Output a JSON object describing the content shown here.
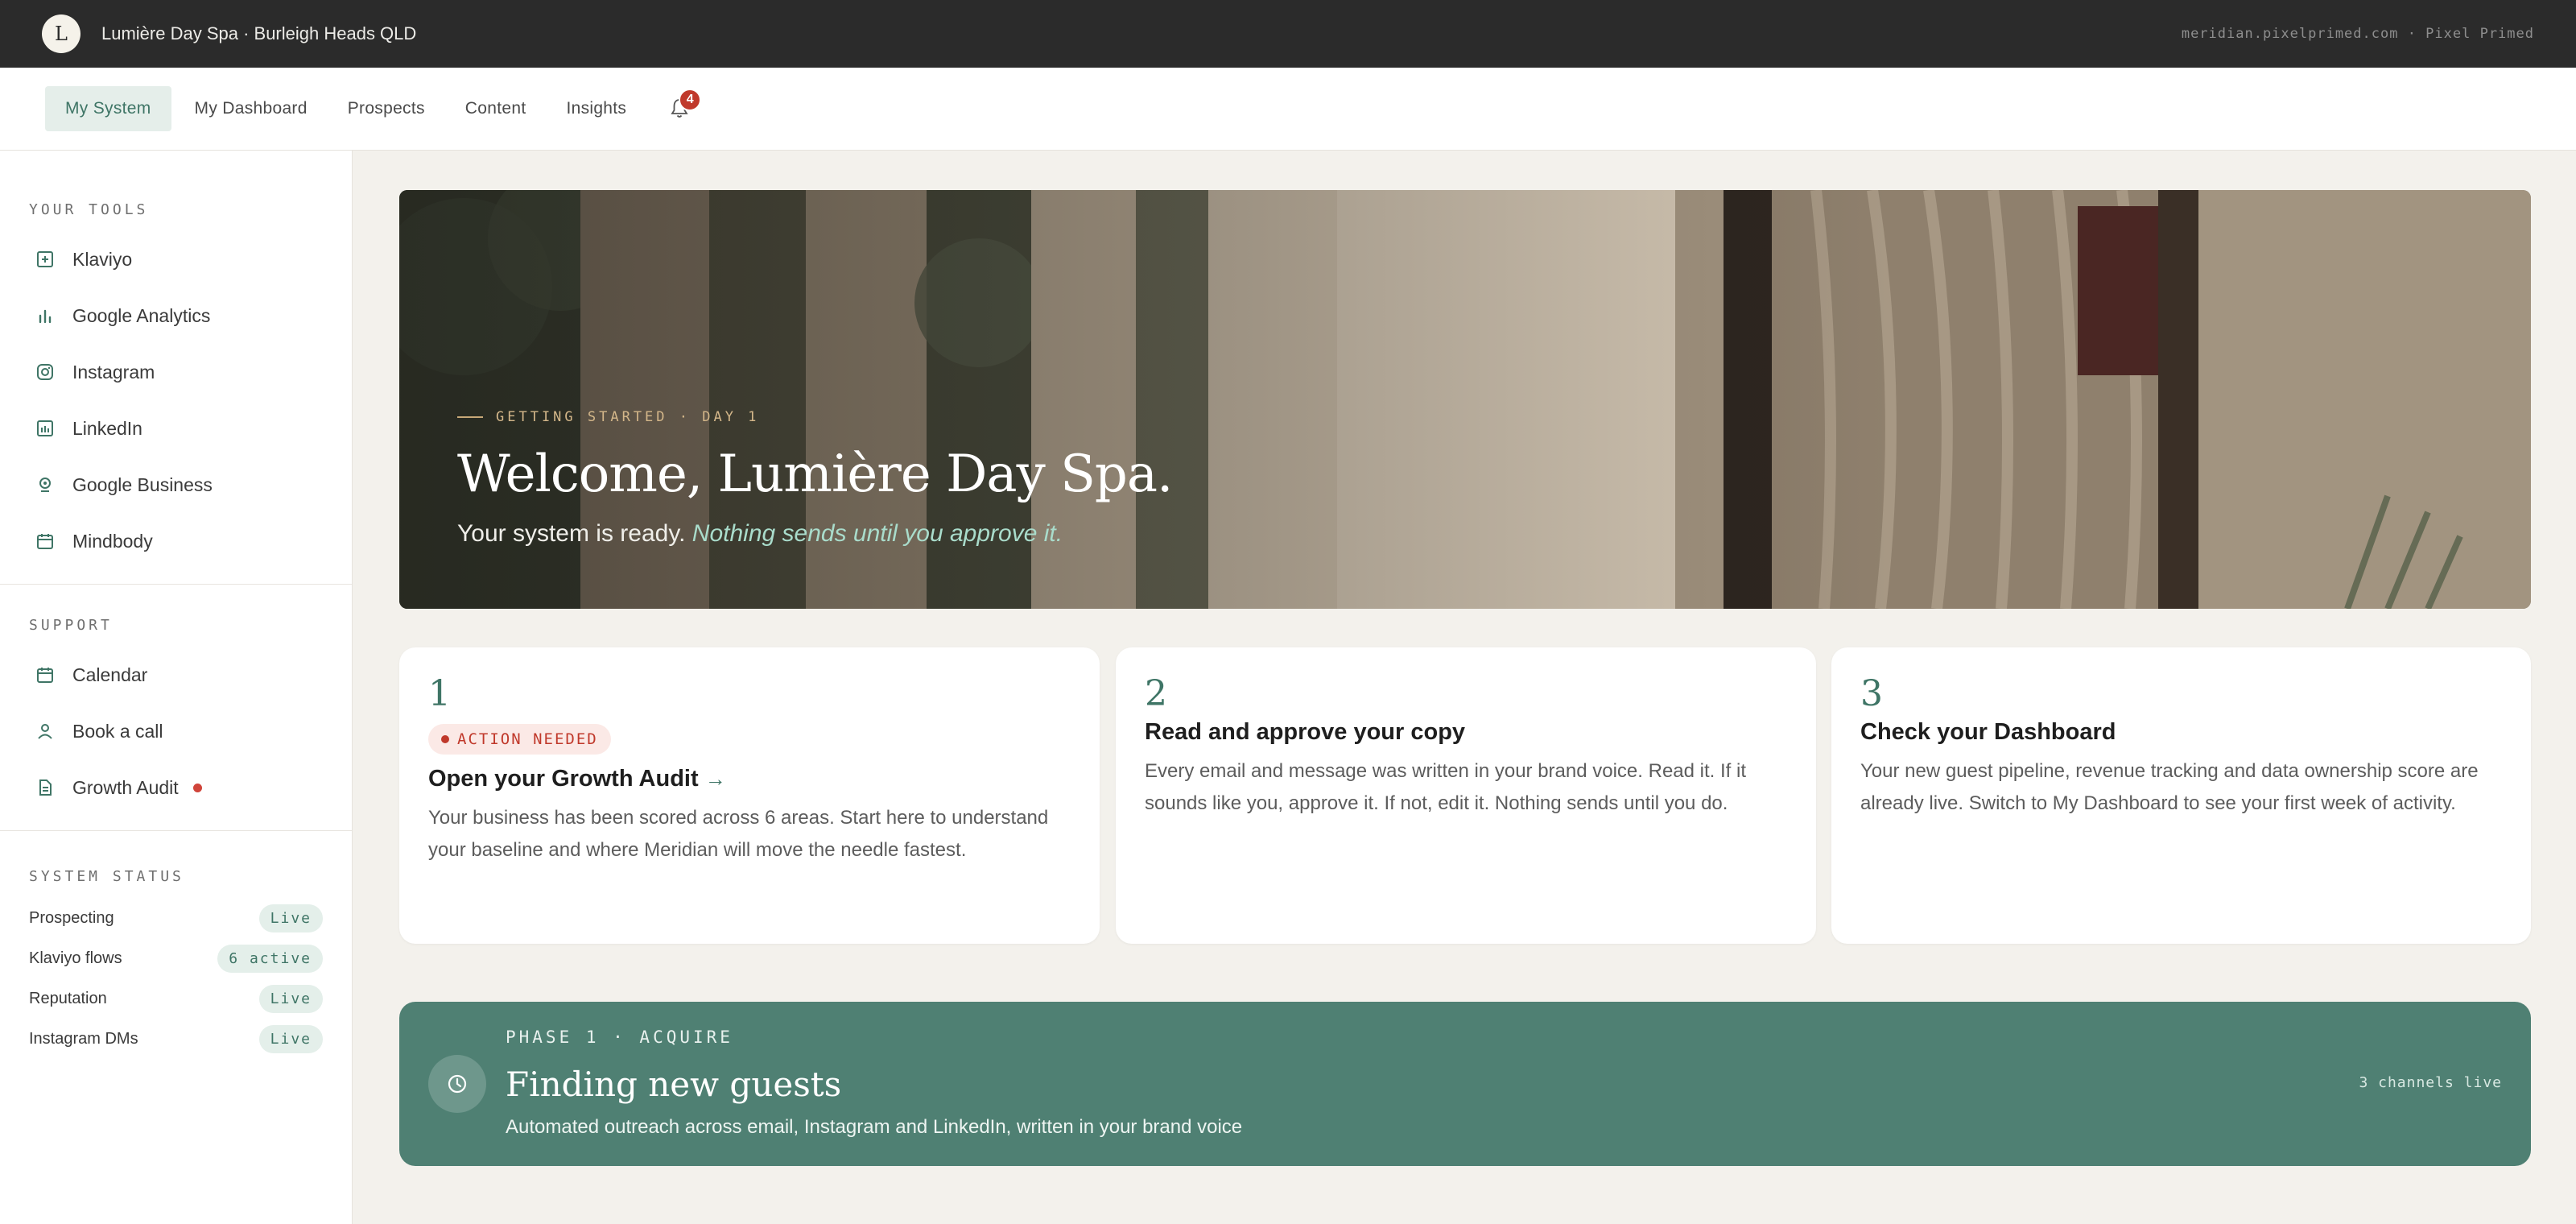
{
  "topbar": {
    "logo_letter": "L",
    "business_name": "Lumière Day Spa · Burleigh Heads QLD",
    "right_text": "meridian.pixelprimed.com · Pixel Primed"
  },
  "nav": {
    "tabs": [
      {
        "label": "My System",
        "active": true
      },
      {
        "label": "My Dashboard"
      },
      {
        "label": "Prospects"
      },
      {
        "label": "Content"
      },
      {
        "label": "Insights"
      }
    ],
    "notification_count": "4"
  },
  "sidebar": {
    "tools_heading": "YOUR TOOLS",
    "tools": [
      {
        "label": "Klaviyo",
        "icon": "klaviyo-icon"
      },
      {
        "label": "Google Analytics",
        "icon": "bar-chart-icon"
      },
      {
        "label": "Instagram",
        "icon": "instagram-icon"
      },
      {
        "label": "LinkedIn",
        "icon": "linkedin-icon"
      },
      {
        "label": "Google Business",
        "icon": "location-pin-icon"
      },
      {
        "label": "Mindbody",
        "icon": "calendar-icon"
      }
    ],
    "support_heading": "SUPPORT",
    "support": [
      {
        "label": "Calendar",
        "icon": "calendar-icon"
      },
      {
        "label": "Book a call",
        "icon": "person-icon"
      },
      {
        "label": "Growth Audit",
        "icon": "document-icon",
        "alert": true
      }
    ],
    "status_heading": "SYSTEM STATUS",
    "status": [
      {
        "label": "Prospecting",
        "value": "Live"
      },
      {
        "label": "Klaviyo flows",
        "value": "6 active"
      },
      {
        "label": "Reputation",
        "value": "Live"
      },
      {
        "label": "Instagram DMs",
        "value": "Live"
      }
    ]
  },
  "hero": {
    "eyebrow": "GETTING STARTED · DAY 1",
    "title": "Welcome, Lumière Day Spa.",
    "subtitle_plain": "Your system is ready.",
    "subtitle_emphasis": "Nothing sends until you approve it."
  },
  "steps": [
    {
      "number": "1",
      "badge": "ACTION NEEDED",
      "title": "Open your Growth Audit",
      "arrow": "→",
      "body": "Your business has been scored across 6 areas. Start here to understand your baseline and where Meridian will move the needle fastest."
    },
    {
      "number": "2",
      "title": "Read and approve your copy",
      "body": "Every email and message was written in your brand voice. Read it. If it sounds like you, approve it. If not, edit it. Nothing sends until you do."
    },
    {
      "number": "3",
      "title": "Check your Dashboard",
      "body": "Your new guest pipeline, revenue tracking and data ownership score are already live. Switch to My Dashboard to see your first week of activity."
    }
  ],
  "phase": {
    "eyebrow": "PHASE 1 · ACQUIRE",
    "title": "Finding new guests",
    "subtitle": "Automated outreach across email, Instagram and LinkedIn, written in your brand voice",
    "right": "3 channels live",
    "icon": "clock-icon"
  },
  "colors": {
    "accent": "#3f7566",
    "phase_bg": "#4f8073",
    "alert": "#c0392b",
    "topbar": "#2b2b2b"
  }
}
